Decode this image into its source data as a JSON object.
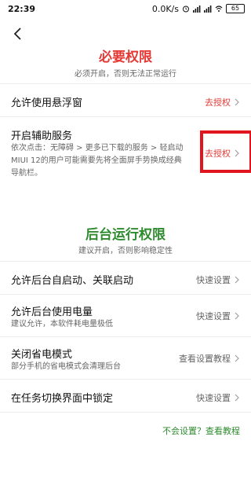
{
  "status_bar": {
    "time": "22:39",
    "network_speed": "0.0K/s",
    "battery": "65"
  },
  "required": {
    "title": "必要权限",
    "subtitle": "必须开启，否则无法正常运行",
    "rows": [
      {
        "title": "允许使用悬浮窗",
        "action": "去授权"
      },
      {
        "title": "开启辅助服务",
        "desc_lines": [
          "依次点击：无障碍 > 更多已下载的服务 > 轻启动",
          "MIUI 12的用户可能需要先将全面屏手势换成经典",
          "导航栏。"
        ],
        "action": "去授权"
      }
    ]
  },
  "background": {
    "title": "后台运行权限",
    "subtitle": "建议开启，否则影响稳定性",
    "rows": [
      {
        "title": "允许后台自启动、关联启动",
        "action": "快速设置"
      },
      {
        "title": "允许后台使用电量",
        "desc": "建议允许，本软件耗电量极低",
        "action": "快速设置"
      },
      {
        "title": "关闭省电模式",
        "desc": "部分手机的省电模式会清理后台",
        "action": "查看设置教程"
      },
      {
        "title": "在任务切换界面中锁定",
        "action": "快速设置"
      }
    ]
  },
  "help_link": "不会设置？查看教程",
  "colors": {
    "red": "#e53935",
    "green": "#2e8b2e",
    "highlight": "#e0151d"
  }
}
